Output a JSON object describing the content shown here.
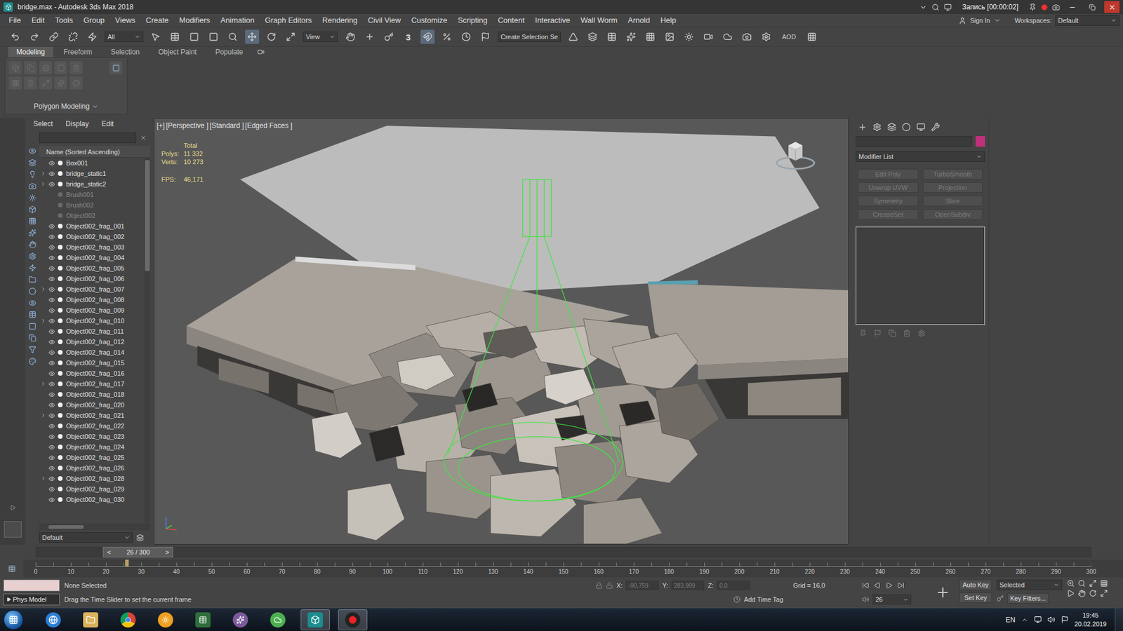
{
  "window": {
    "title": "bridge.max - Autodesk 3ds Max 2018",
    "recording": "Запись [00:00:02]"
  },
  "menu": [
    "File",
    "Edit",
    "Tools",
    "Group",
    "Views",
    "Create",
    "Modifiers",
    "Animation",
    "Graph Editors",
    "Rendering",
    "Civil View",
    "Customize",
    "Scripting",
    "Content",
    "Interactive",
    "Wall Worm",
    "Arnold",
    "Help"
  ],
  "account": {
    "sign_in": "Sign In",
    "workspaces_label": "Workspaces:",
    "workspace": "Default"
  },
  "toolbar": {
    "filter": "All",
    "coord": "View",
    "snap": "3",
    "selection_set": "Create Selection Se",
    "aod": "AOD"
  },
  "ribbon": {
    "tabs": [
      {
        "label": "Modeling",
        "selected": true
      },
      {
        "label": "Freeform",
        "selected": false
      },
      {
        "label": "Selection",
        "selected": false
      },
      {
        "label": "Object Paint",
        "selected": false
      },
      {
        "label": "Populate",
        "selected": false
      }
    ],
    "panel": "Polygon Modeling"
  },
  "explorer": {
    "menu": [
      "Select",
      "Display",
      "Edit"
    ],
    "header": "Name (Sorted Ascending)",
    "layer": "Default",
    "rows": [
      {
        "name": "Box001",
        "visible": true,
        "expandable": false,
        "dimmed": false
      },
      {
        "name": "bridge_static1",
        "visible": true,
        "expandable": true,
        "dimmed": false
      },
      {
        "name": "bridge_static2",
        "visible": true,
        "expandable": true,
        "dimmed": false
      },
      {
        "name": "Brush001",
        "visible": false,
        "expandable": false,
        "dimmed": true
      },
      {
        "name": "Brush002",
        "visible": false,
        "expandable": false,
        "dimmed": true
      },
      {
        "name": "Object002",
        "visible": false,
        "expandable": false,
        "dimmed": true
      },
      {
        "name": "Object002_frag_001",
        "visible": true,
        "expandable": false,
        "dimmed": false
      },
      {
        "name": "Object002_frag_002",
        "visible": true,
        "expandable": false,
        "dimmed": false
      },
      {
        "name": "Object002_frag_003",
        "visible": true,
        "expandable": false,
        "dimmed": false
      },
      {
        "name": "Object002_frag_004",
        "visible": true,
        "expandable": false,
        "dimmed": false
      },
      {
        "name": "Object002_frag_005",
        "visible": true,
        "expandable": false,
        "dimmed": false
      },
      {
        "name": "Object002_frag_006",
        "visible": true,
        "expandable": false,
        "dimmed": false
      },
      {
        "name": "Object002_frag_007",
        "visible": true,
        "expandable": true,
        "dimmed": false
      },
      {
        "name": "Object002_frag_008",
        "visible": true,
        "expandable": false,
        "dimmed": false
      },
      {
        "name": "Object002_frag_009",
        "visible": true,
        "expandable": false,
        "dimmed": false
      },
      {
        "name": "Object002_frag_010",
        "visible": true,
        "expandable": true,
        "dimmed": false
      },
      {
        "name": "Object002_frag_011",
        "visible": true,
        "expandable": false,
        "dimmed": false
      },
      {
        "name": "Object002_frag_012",
        "visible": true,
        "expandable": false,
        "dimmed": false
      },
      {
        "name": "Object002_frag_014",
        "visible": true,
        "expandable": false,
        "dimmed": false
      },
      {
        "name": "Object002_frag_015",
        "visible": true,
        "expandable": false,
        "dimmed": false
      },
      {
        "name": "Object002_frag_016",
        "visible": true,
        "expandable": false,
        "dimmed": false
      },
      {
        "name": "Object002_frag_017",
        "visible": true,
        "expandable": true,
        "dimmed": false
      },
      {
        "name": "Object002_frag_018",
        "visible": true,
        "expandable": false,
        "dimmed": false
      },
      {
        "name": "Object002_frag_020",
        "visible": true,
        "expandable": false,
        "dimmed": false
      },
      {
        "name": "Object002_frag_021",
        "visible": true,
        "expandable": true,
        "dimmed": false
      },
      {
        "name": "Object002_frag_022",
        "visible": true,
        "expandable": false,
        "dimmed": false
      },
      {
        "name": "Object002_frag_023",
        "visible": true,
        "expandable": false,
        "dimmed": false
      },
      {
        "name": "Object002_frag_024",
        "visible": true,
        "expandable": false,
        "dimmed": false
      },
      {
        "name": "Object002_frag_025",
        "visible": true,
        "expandable": false,
        "dimmed": false
      },
      {
        "name": "Object002_frag_026",
        "visible": true,
        "expandable": false,
        "dimmed": false
      },
      {
        "name": "Object002_frag_028",
        "visible": true,
        "expandable": true,
        "dimmed": false
      },
      {
        "name": "Object002_frag_029",
        "visible": true,
        "expandable": false,
        "dimmed": false
      },
      {
        "name": "Object002_frag_030",
        "visible": true,
        "expandable": false,
        "dimmed": false
      }
    ]
  },
  "viewport": {
    "labels": [
      "[+]",
      "[Perspective ]",
      "[Standard ]",
      "[Edged Faces ]"
    ],
    "stats": {
      "title": "Total",
      "polys_label": "Polys:",
      "polys": "11 332",
      "verts_label": "Verts:",
      "verts": "10 273",
      "fps_label": "FPS:",
      "fps": "46,171"
    }
  },
  "command_panel": {
    "color": "#c2307c",
    "modifier_list": "Modifier List",
    "buttons": [
      {
        "label": "Edit Poly",
        "disabled": true
      },
      {
        "label": "TurboSmooth",
        "disabled": true
      },
      {
        "label": "Unwrap UVW",
        "disabled": true
      },
      {
        "label": "Projection",
        "disabled": true
      },
      {
        "label": "Symmetry",
        "disabled": true
      },
      {
        "label": "Slice",
        "disabled": true
      },
      {
        "label": "CreaseSet",
        "disabled": true
      },
      {
        "label": "OpenSubdiv",
        "disabled": true
      }
    ]
  },
  "timeline": {
    "frame_label": "26 / 300",
    "prev": "<",
    "next": ">",
    "level": 0.0867,
    "ticks": [
      "0",
      "10",
      "20",
      "30",
      "40",
      "50",
      "60",
      "70",
      "80",
      "90",
      "100",
      "110",
      "120",
      "130",
      "140",
      "150",
      "160",
      "170",
      "180",
      "190",
      "200",
      "210",
      "220",
      "230",
      "240",
      "250",
      "260",
      "270",
      "280",
      "290",
      "300"
    ]
  },
  "status": {
    "script_label": "Phys Model",
    "selection": "None Selected",
    "prompt": "Drag the Time Slider to set the current frame",
    "x_label": "X:",
    "x": "-90,759",
    "y_label": "Y:",
    "y": "283,999",
    "z_label": "Z:",
    "z": "0,0",
    "grid": "Grid = 16,0",
    "time_tag": "Add Time Tag",
    "auto_key": "Auto Key",
    "key_mode": "Selected",
    "set_key": "Set Key",
    "key_filters": "Key Filters...",
    "frame": "26"
  },
  "taskbar": {
    "lang": "EN",
    "time": "19:45",
    "date": "20.02.2019"
  }
}
